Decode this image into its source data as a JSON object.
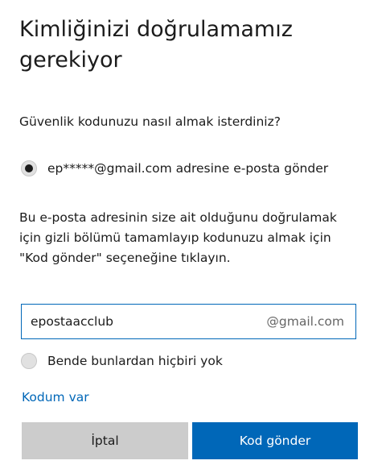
{
  "header": {
    "title": "Kimliğinizi doğrulamamız gerekiyor"
  },
  "form": {
    "question": "Güvenlik kodunuzu nasıl almak isterdiniz?",
    "options": [
      {
        "label": "ep*****@gmail.com adresine e-posta gönder",
        "selected": true
      },
      {
        "label": "Bende bunlardan hiçbiri yok",
        "selected": false
      }
    ],
    "description": "Bu e-posta adresinin size ait olduğunu doğrulamak için gizli bölümü tamamlayıp kodunuzu almak için \"Kod gönder\" seçeneğine tıklayın.",
    "email_input": {
      "value": "epostaacclub",
      "suffix": "@gmail.com"
    },
    "have_code_link": "Kodum var"
  },
  "buttons": {
    "cancel_label": "İptal",
    "send_label": "Kod gönder"
  },
  "colors": {
    "accent": "#0067b8",
    "cancel_bg": "#cccccc",
    "text": "#1b1b1b"
  }
}
